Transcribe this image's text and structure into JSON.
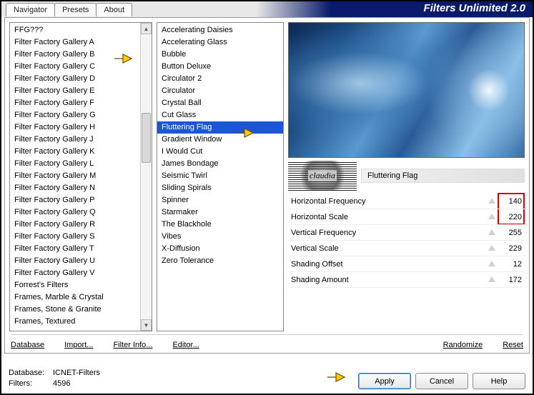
{
  "title": "Filters Unlimited 2.0",
  "tabs": {
    "navigator": "Navigator",
    "presets": "Presets",
    "about": "About"
  },
  "categories": [
    "FFG???",
    "Filter Factory Gallery A",
    "Filter Factory Gallery B",
    "Filter Factory Gallery C",
    "Filter Factory Gallery D",
    "Filter Factory Gallery E",
    "Filter Factory Gallery F",
    "Filter Factory Gallery G",
    "Filter Factory Gallery H",
    "Filter Factory Gallery J",
    "Filter Factory Gallery K",
    "Filter Factory Gallery L",
    "Filter Factory Gallery M",
    "Filter Factory Gallery N",
    "Filter Factory Gallery P",
    "Filter Factory Gallery Q",
    "Filter Factory Gallery R",
    "Filter Factory Gallery S",
    "Filter Factory Gallery T",
    "Filter Factory Gallery U",
    "Filter Factory Gallery V",
    "Forrest's Filters",
    "Frames, Marble & Crystal",
    "Frames, Stone & Granite",
    "Frames, Textured"
  ],
  "filters": [
    "Accelerating Daisies",
    "Accelerating Glass",
    "Bubble",
    "Button Deluxe",
    "Circulator 2",
    "Circulator",
    "Crystal Ball",
    "Cut Glass",
    "Fluttering Flag",
    "Gradient Window",
    "I Would Cut",
    "James Bondage",
    "Seismic Twirl",
    "Sliding Spirals",
    "Spinner",
    "Starmaker",
    "The Blackhole",
    "Vibes",
    "X-Diffusion",
    "Zero Tolerance"
  ],
  "selectedFilterIndex": 8,
  "filterName": "Fluttering Flag",
  "params": [
    {
      "label": "Horizontal Frequency",
      "value": "140",
      "hl": true
    },
    {
      "label": "Horizontal Scale",
      "value": "220",
      "hl": true
    },
    {
      "label": "Vertical Frequency",
      "value": "255",
      "hl": false
    },
    {
      "label": "Vertical Scale",
      "value": "229",
      "hl": false
    },
    {
      "label": "Shading Offset",
      "value": "12",
      "hl": false
    },
    {
      "label": "Shading Amount",
      "value": "172",
      "hl": false
    }
  ],
  "links": {
    "database": "Database",
    "import": "Import...",
    "filterinfo": "Filter Info...",
    "editor": "Editor...",
    "randomize": "Randomize",
    "reset": "Reset"
  },
  "status": {
    "dbLabel": "Database:",
    "dbValue": "ICNET-Filters",
    "filtersLabel": "Filters:",
    "filtersValue": "4596"
  },
  "buttons": {
    "apply": "Apply",
    "cancel": "Cancel",
    "help": "Help"
  }
}
